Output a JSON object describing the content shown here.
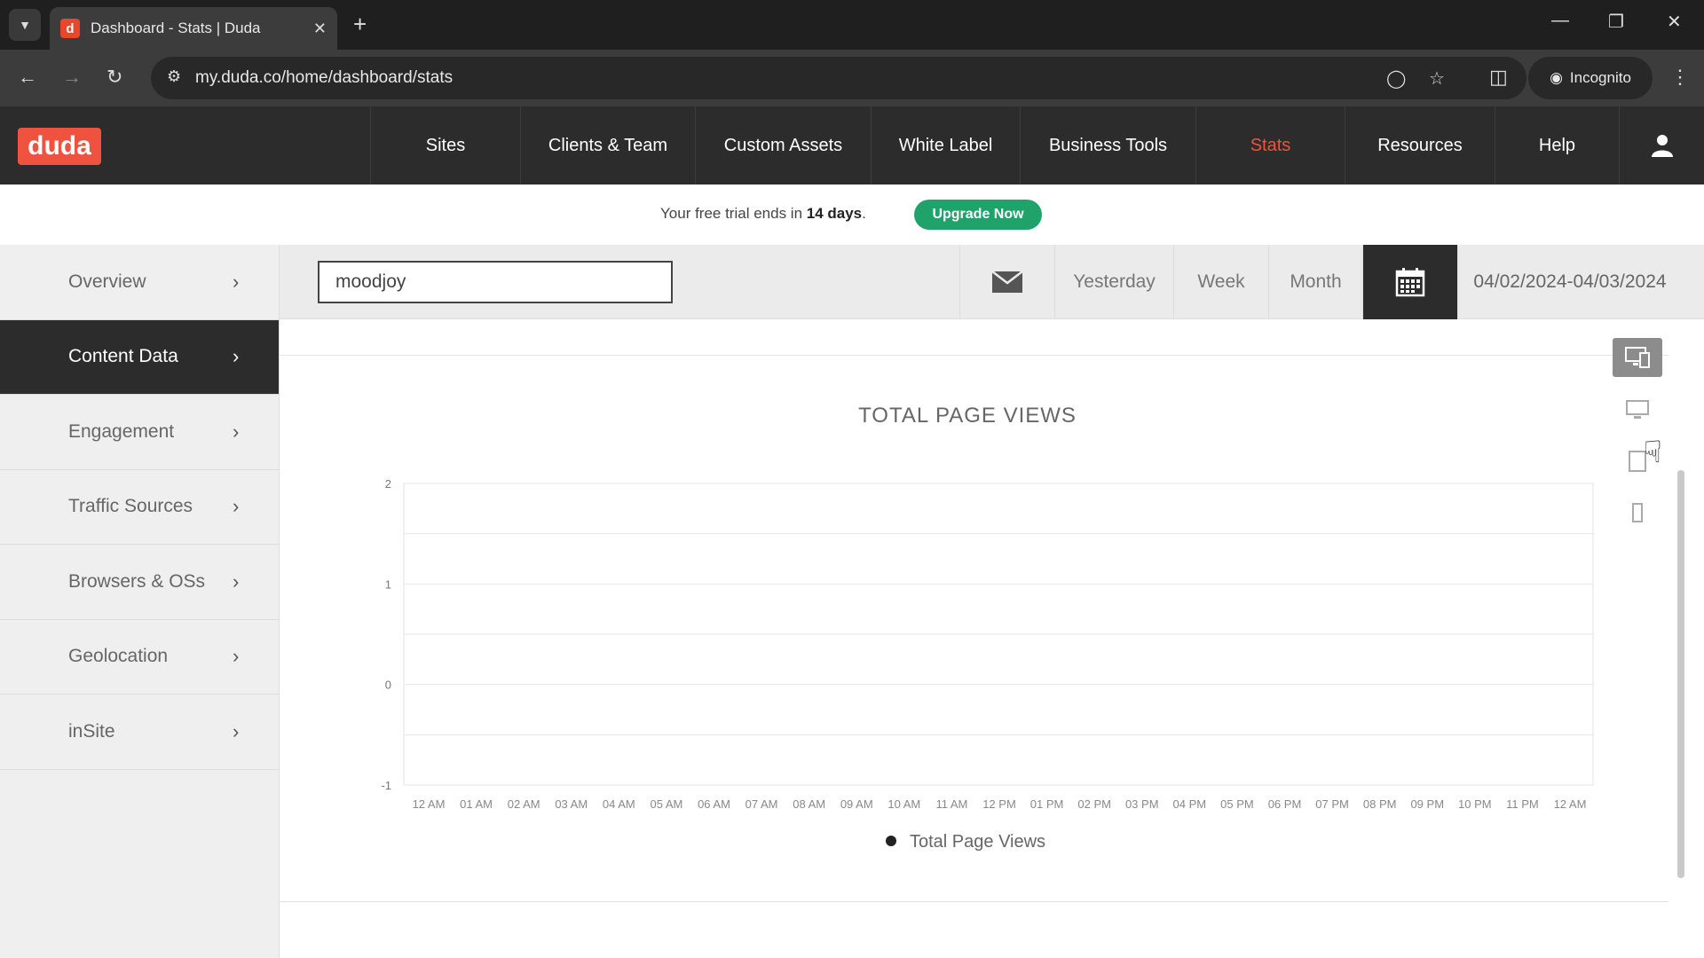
{
  "browser": {
    "tab_title": "Dashboard - Stats | Duda",
    "favicon_letter": "d",
    "url": "my.duda.co/home/dashboard/stats",
    "incognito_label": "Incognito"
  },
  "header": {
    "logo": "duda",
    "nav": [
      {
        "label": "Sites"
      },
      {
        "label": "Clients & Team"
      },
      {
        "label": "Custom Assets"
      },
      {
        "label": "White Label"
      },
      {
        "label": "Business Tools"
      },
      {
        "label": "Stats",
        "active": true
      },
      {
        "label": "Resources"
      },
      {
        "label": "Help"
      }
    ]
  },
  "trial": {
    "text_before": "Your free trial ends in ",
    "days": "14 days",
    "text_after": ".",
    "button": "Upgrade Now"
  },
  "sidebar": {
    "items": [
      {
        "label": "Overview"
      },
      {
        "label": "Content Data",
        "active": true
      },
      {
        "label": "Engagement"
      },
      {
        "label": "Traffic Sources"
      },
      {
        "label": "Browsers & OSs"
      },
      {
        "label": "Geolocation"
      },
      {
        "label": "inSite"
      }
    ]
  },
  "controls": {
    "site_value": "moodjoy",
    "ranges": [
      "Yesterday",
      "Week",
      "Month"
    ],
    "date_range": "04/02/2024-04/03/2024"
  },
  "chart_data": {
    "type": "line",
    "title": "TOTAL PAGE VIEWS",
    "x": [
      "12 AM",
      "01 AM",
      "02 AM",
      "03 AM",
      "04 AM",
      "05 AM",
      "06 AM",
      "07 AM",
      "08 AM",
      "09 AM",
      "10 AM",
      "11 AM",
      "12 PM",
      "01 PM",
      "02 PM",
      "03 PM",
      "04 PM",
      "05 PM",
      "06 PM",
      "07 PM",
      "08 PM",
      "09 PM",
      "10 PM",
      "11 PM",
      "12 AM"
    ],
    "y_ticks": [
      "2",
      "1",
      "0",
      "-1"
    ],
    "ylim": [
      -1,
      2
    ],
    "series": [
      {
        "name": "Total Page Views",
        "values": []
      }
    ],
    "legend_position": "bottom",
    "grid": true
  },
  "colors": {
    "brand": "#ef5340",
    "header_bg": "#2c2c2c",
    "upgrade": "#1fa36b"
  },
  "device_views": [
    "all-devices-icon",
    "desktop-icon",
    "tablet-icon",
    "mobile-icon"
  ]
}
